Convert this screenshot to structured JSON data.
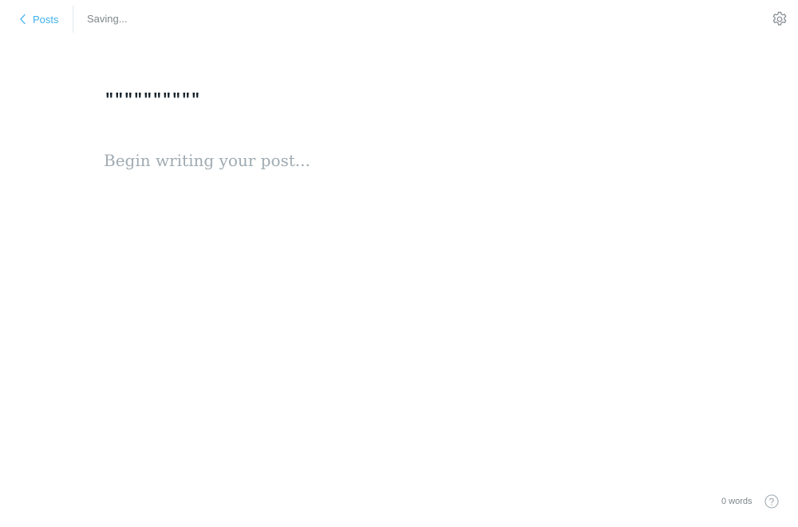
{
  "header": {
    "back_label": "Posts",
    "status": "Saving..."
  },
  "icons": {
    "back": "chevron-left-icon",
    "settings": "gear-icon",
    "help": "question-circle-icon"
  },
  "editor": {
    "title_value": "\"\"\"\"\"\"\"\"\"\"",
    "body_placeholder": "Begin writing your post..."
  },
  "footer": {
    "word_count": "0 words"
  },
  "colors": {
    "accent": "#3eb0ef",
    "muted_text": "#7d878a",
    "placeholder": "#9fabb2",
    "title_text": "#15212a"
  }
}
